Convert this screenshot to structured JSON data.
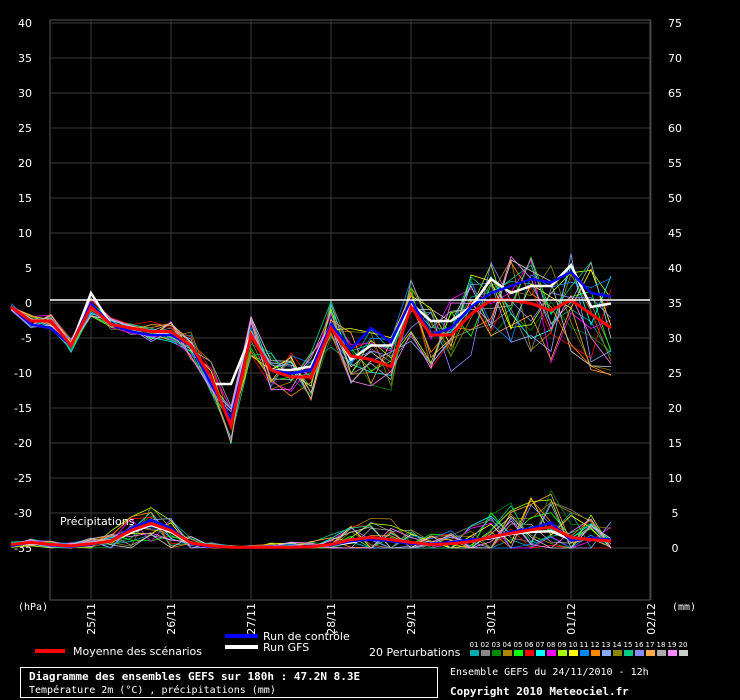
{
  "chart_data": {
    "type": "line",
    "title": "Diagramme des ensembles GEFS sur 180h : 47.2N 8.3E",
    "subtitle": "Température 2m (°C) , précipitations (mm)",
    "y_left_label": "(hPa)",
    "y_right_label": "(mm)",
    "y_left_ticks": [
      "40",
      "35",
      "30",
      "25",
      "20",
      "15",
      "10",
      "5",
      "0",
      "-5",
      "-10",
      "-15",
      "-20",
      "-25",
      "-30",
      "-35"
    ],
    "y_right_ticks": [
      "75",
      "70",
      "65",
      "60",
      "55",
      "50",
      "45",
      "40",
      "35",
      "30",
      "25",
      "20",
      "15",
      "10",
      "5",
      "0"
    ],
    "x_labels": [
      "25/11",
      "26/11",
      "27/11",
      "28/11",
      "29/11",
      "30/11",
      "01/12",
      "02/12"
    ],
    "precip_label": "Précipitations",
    "temp_ylim": [
      -35,
      40
    ],
    "precip_ylim": [
      0,
      75
    ],
    "x_step_hours": 6,
    "series": [
      {
        "name": "Moyenne des scénarios",
        "color": "#ff0000",
        "temperature": [
          -1,
          -3,
          -3,
          -6.5,
          -1,
          -3.5,
          -4,
          -4.5,
          -4.5,
          -6.5,
          -11,
          -18,
          -5,
          -10,
          -11,
          -11,
          -4,
          -8,
          -8.5,
          -9.5,
          -1,
          -5,
          -5,
          -2,
          0,
          0,
          -0.5,
          -1.5,
          0,
          -2,
          -4
        ],
        "precipitation": [
          0.5,
          0.8,
          0.5,
          0.3,
          0.6,
          1,
          2.5,
          3.5,
          2.5,
          0.7,
          0.3,
          0.1,
          0.1,
          0.1,
          0.1,
          0.2,
          0.5,
          1.2,
          1.5,
          1.2,
          0.8,
          0.5,
          0.6,
          0.9,
          1.6,
          2.1,
          2.6,
          3,
          1.5,
          1.2,
          1.0
        ]
      },
      {
        "name": "Run de contrôle",
        "color": "#0000ff",
        "temperature": [
          -1,
          -3.5,
          -4,
          -6.5,
          -0.5,
          -3.5,
          -4.5,
          -5,
          -5,
          -6.5,
          -12,
          -17,
          -5,
          -10,
          -10.5,
          -10,
          -3.5,
          -7,
          -4,
          -6,
          0,
          -5,
          -4,
          -1,
          1,
          2,
          3,
          2.5,
          4,
          1,
          0.5
        ],
        "precipitation": [
          0.3,
          0.8,
          0.4,
          0.2,
          0.5,
          1,
          2.8,
          4,
          2.8,
          0.6,
          0.2,
          0.1,
          0.1,
          0.2,
          0.1,
          0.3,
          0.4,
          1,
          1.2,
          1,
          0.6,
          0.6,
          0.8,
          1.2,
          1.5,
          2.3,
          2.8,
          3.6,
          1.1,
          1.4,
          1.2
        ]
      },
      {
        "name": "Run GFS",
        "color": "#ffffff",
        "temperature": [
          -1,
          -3.5,
          -4,
          -6.5,
          1,
          -3.5,
          -4,
          -4.5,
          -5,
          -6.5,
          -12,
          -12,
          -5,
          -10,
          -10,
          -9.5,
          -3.5,
          -8.5,
          -6.5,
          -6.5,
          -0.5,
          -3,
          -3,
          -1,
          3,
          1,
          2,
          2,
          5,
          -1,
          -0.5
        ],
        "precipitation": [
          0.4,
          0.7,
          0.4,
          0.2,
          0.7,
          1.1,
          2.2,
          3.3,
          2.3,
          0.6,
          0.3,
          0.1,
          0.1,
          0.1,
          0.1,
          0.2,
          0.4,
          0.8,
          1.4,
          1.0,
          0.7,
          0.5,
          0.7,
          1,
          1.4,
          2,
          2.3,
          2.4,
          1.2,
          1.3,
          1.1
        ]
      }
    ]
  },
  "perturbations": {
    "count": 20,
    "legend_label": "20 Perturbations",
    "numbers": [
      "01",
      "02",
      "03",
      "04",
      "05",
      "06",
      "07",
      "08",
      "09",
      "10",
      "11",
      "12",
      "13",
      "14",
      "15",
      "16",
      "17",
      "18",
      "19",
      "20"
    ],
    "colors": [
      "#00aaaa",
      "#888888",
      "#008800",
      "#aa8800",
      "#00ff00",
      "#ff0000",
      "#00ffff",
      "#ff00ff",
      "#aaff00",
      "#ffff00",
      "#0088ff",
      "#ff8800",
      "#88aaff",
      "#888800",
      "#00cc88",
      "#8888ff",
      "#ffaa44",
      "#aaaaaa",
      "#ff88ff",
      "#cccccc"
    ],
    "spread_temp": [
      0.5,
      1,
      1,
      1,
      1.5,
      1,
      1,
      1.5,
      1.5,
      2,
      2.5,
      3,
      3,
      3,
      3.5,
      3.5,
      4,
      4,
      4.5,
      4.5,
      5,
      5,
      5.5,
      6,
      6.5,
      7,
      7,
      7.5,
      8,
      8,
      8
    ],
    "spread_precip": [
      0.4,
      0.5,
      0.5,
      0.5,
      1,
      1.5,
      2.5,
      3,
      2.5,
      1,
      0.5,
      0.3,
      0.4,
      0.6,
      0.8,
      1,
      1.5,
      2,
      3,
      3,
      2,
      1.5,
      2,
      3,
      4,
      4.5,
      5,
      5.5,
      4,
      3.5,
      3.5
    ]
  },
  "footer": {
    "ensemble_run": "Ensemble GEFS du 24/11/2010 - 12h",
    "copyright": "Copyright 2010 Meteociel.fr"
  }
}
